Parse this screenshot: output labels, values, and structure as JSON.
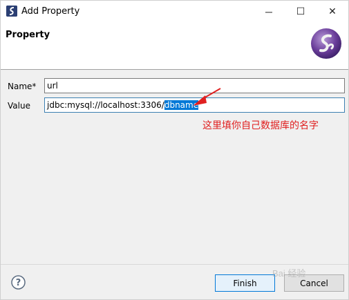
{
  "window": {
    "title": "Add Property",
    "controls": {
      "minimize": "─",
      "maximize": "☐",
      "close": "✕"
    }
  },
  "header": {
    "title": "Property",
    "logo_icon": "eclipse-datatools-logo-icon"
  },
  "form": {
    "name_label": "Name*",
    "name_value": "url",
    "value_label": "Value",
    "value_prefix": "jdbc:mysql://localhost:3306/",
    "value_selected": "dbname"
  },
  "annotation": {
    "text": "这里填你自己数据库的名字",
    "color": "#e02020"
  },
  "footer": {
    "help_icon": "help-icon",
    "finish_label": "Finish",
    "cancel_label": "Cancel"
  },
  "watermark": {
    "text": "Bai 经验"
  },
  "colors": {
    "selection": "#0078d7",
    "annotation": "#e02020"
  }
}
